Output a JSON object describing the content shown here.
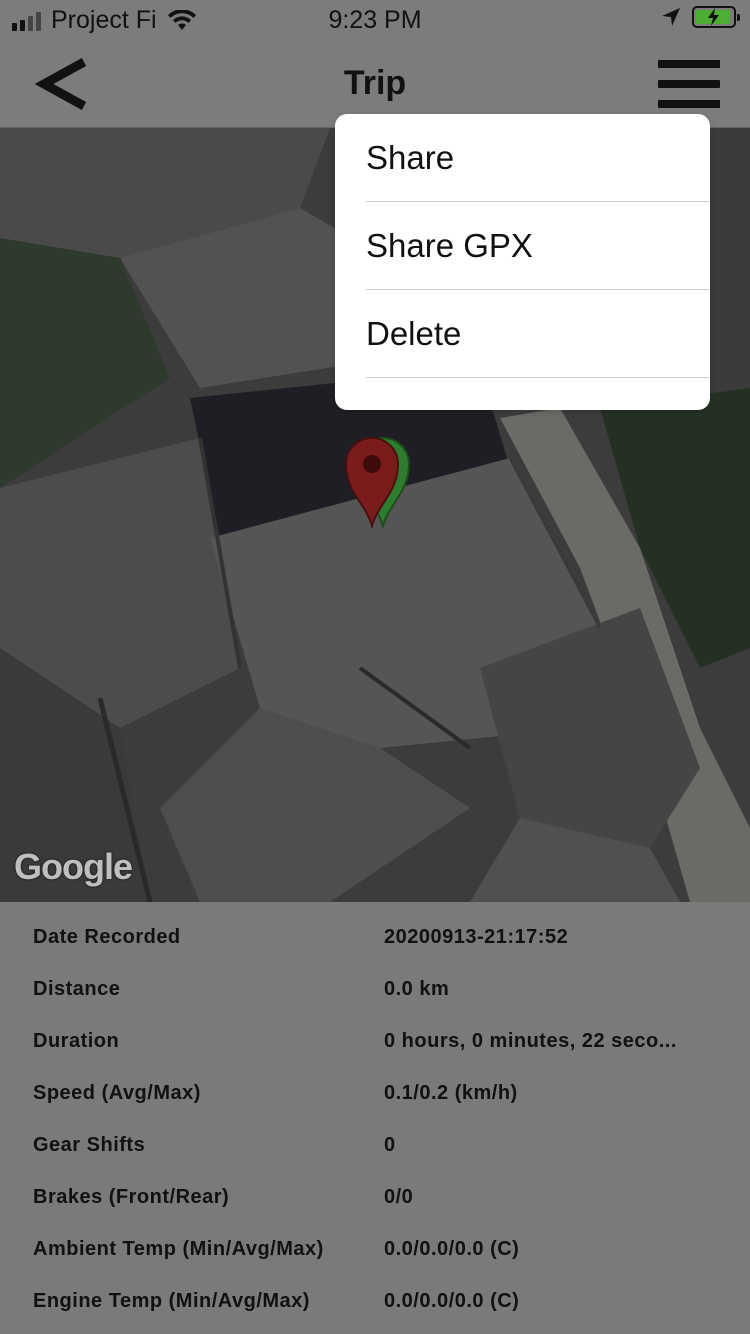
{
  "status_bar": {
    "carrier": "Project Fi",
    "time": "9:23 PM",
    "battery_color": "#4caf33"
  },
  "nav": {
    "title": "Trip",
    "back_icon": "chevron-left-icon",
    "menu_icon": "hamburger-menu-icon"
  },
  "map": {
    "attribution": "Google",
    "pins": [
      {
        "color": "#2e7d2e",
        "role": "start"
      },
      {
        "color": "#7b1c1c",
        "role": "end"
      }
    ]
  },
  "menu": {
    "items": [
      {
        "label": "Share"
      },
      {
        "label": "Share GPX"
      },
      {
        "label": "Delete"
      }
    ]
  },
  "details": {
    "rows": [
      {
        "label": "Date Recorded",
        "value": "20200913-21:17:52"
      },
      {
        "label": "Distance",
        "value": "0.0 km"
      },
      {
        "label": "Duration",
        "value": "0 hours, 0 minutes, 22 seco..."
      },
      {
        "label": "Speed (Avg/Max)",
        "value": "0.1/0.2 (km/h)"
      },
      {
        "label": "Gear Shifts",
        "value": "0"
      },
      {
        "label": "Brakes (Front/Rear)",
        "value": "0/0"
      },
      {
        "label": "Ambient Temp (Min/Avg/Max)",
        "value": "0.0/0.0/0.0 (C)"
      },
      {
        "label": "Engine Temp (Min/Avg/Max)",
        "value": "0.0/0.0/0.0 (C)"
      }
    ]
  }
}
